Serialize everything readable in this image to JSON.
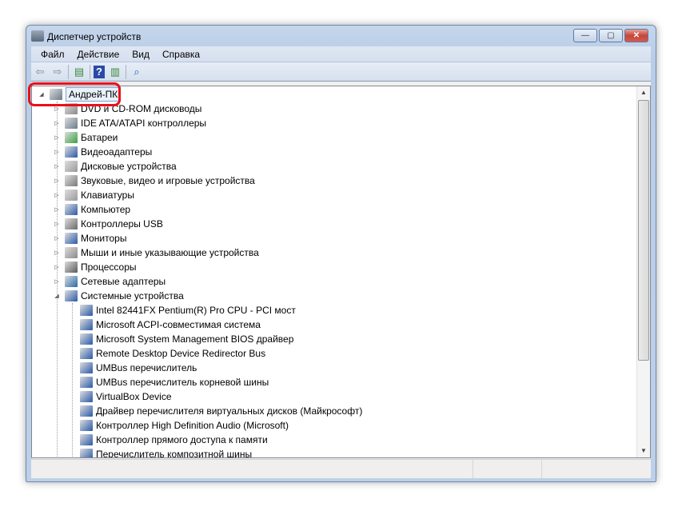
{
  "window": {
    "title": "Диспетчер устройств",
    "icon": "device-manager-icon"
  },
  "window_controls": {
    "minimize": "—",
    "maximize": "▢",
    "close": "✕"
  },
  "menu": [
    "Файл",
    "Действие",
    "Вид",
    "Справка"
  ],
  "toolbar": [
    "back-icon",
    "forward-icon",
    "properties-icon",
    "help-icon",
    "show-hide-icon",
    "scan-hardware-icon"
  ],
  "tree": {
    "root": "Андрей-ПК",
    "categories": [
      {
        "label": "DVD и CD-ROM дисководы",
        "icon": "dvd-icon",
        "color": "#8a8a8a"
      },
      {
        "label": "IDE ATA/ATAPI контроллеры",
        "icon": "ide-controller-icon",
        "color": "#6a7a8a"
      },
      {
        "label": "Батареи",
        "icon": "battery-icon",
        "color": "#3aa040"
      },
      {
        "label": "Видеоадаптеры",
        "icon": "display-adapter-icon",
        "color": "#2a5aa8"
      },
      {
        "label": "Дисковые устройства",
        "icon": "disk-drive-icon",
        "color": "#9a9a9a"
      },
      {
        "label": "Звуковые, видео и игровые устройства",
        "icon": "sound-icon",
        "color": "#7a7a7a"
      },
      {
        "label": "Клавиатуры",
        "icon": "keyboard-icon",
        "color": "#9a9a9a"
      },
      {
        "label": "Компьютер",
        "icon": "computer-icon",
        "color": "#2a5aa8"
      },
      {
        "label": "Контроллеры USB",
        "icon": "usb-icon",
        "color": "#6a6a6a"
      },
      {
        "label": "Мониторы",
        "icon": "monitor-icon",
        "color": "#2a5aa8"
      },
      {
        "label": "Мыши и иные указывающие устройства",
        "icon": "mouse-icon",
        "color": "#8a8a8a"
      },
      {
        "label": "Процессоры",
        "icon": "processor-icon",
        "color": "#5a5a5a"
      },
      {
        "label": "Сетевые адаптеры",
        "icon": "network-adapter-icon",
        "color": "#2a6aa8"
      },
      {
        "label": "Системные устройства",
        "icon": "system-device-icon",
        "color": "#2a5aa8",
        "expanded": true
      }
    ],
    "system_devices": [
      "Intel 82441FX Pentium(R) Pro CPU - PCI мост",
      "Microsoft ACPI-совместимая система",
      "Microsoft System Management BIOS драйвер",
      "Remote Desktop Device Redirector Bus",
      "UMBus перечислитель",
      "UMBus перечислитель корневой шины",
      "VirtualBox Device",
      "Драйвер перечислителя виртуальных дисков (Майкрософт)",
      "Контроллер High Definition Audio (Microsoft)",
      "Контроллер прямого доступа к памяти",
      "Перечислитель композитной шины"
    ]
  },
  "colors": {
    "highlight": "#e8101c"
  }
}
